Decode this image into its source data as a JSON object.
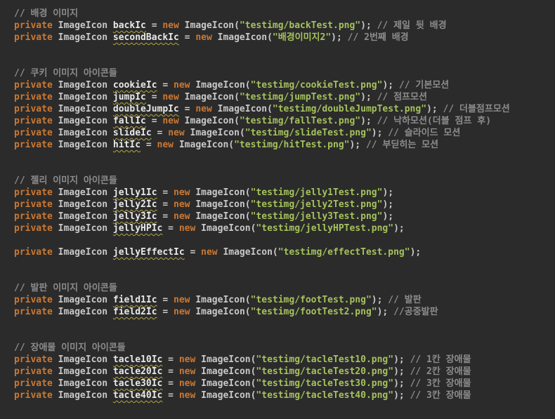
{
  "editor": {
    "lines": [
      {
        "type": "comment",
        "text": "// 배경 이미지"
      },
      {
        "type": "decl",
        "kw": "private",
        "type_name": "ImageIcon",
        "ident": "backIc",
        "eq": " = ",
        "new_kw": "new",
        "ctor": " ImageIcon(",
        "str": "\"testimg/backTest.png\"",
        "close": ");",
        "trail": " // 제일 뒷 배경"
      },
      {
        "type": "decl",
        "kw": "private",
        "type_name": "ImageIcon",
        "ident": "secondBackIc",
        "eq": " = ",
        "new_kw": "new",
        "ctor": " ImageIcon(",
        "str": "\"배경이미지2\"",
        "close": ");",
        "trail": " // 2번째 배경"
      },
      {
        "type": "blank"
      },
      {
        "type": "blank"
      },
      {
        "type": "comment",
        "text": "// 쿠키 이미지 아이콘들"
      },
      {
        "type": "decl",
        "kw": "private",
        "type_name": "ImageIcon",
        "ident": "cookieIc",
        "eq": " = ",
        "new_kw": "new",
        "ctor": " ImageIcon(",
        "str": "\"testimg/cookieTest.png\"",
        "close": ");",
        "trail": " // 기본모션"
      },
      {
        "type": "decl",
        "kw": "private",
        "type_name": "ImageIcon",
        "ident": "jumpIc",
        "eq": " = ",
        "new_kw": "new",
        "ctor": " ImageIcon(",
        "str": "\"testimg/jumpTest.png\"",
        "close": ");",
        "trail": " // 점프모션"
      },
      {
        "type": "decl",
        "kw": "private",
        "type_name": "ImageIcon",
        "ident": "doubleJumpIc",
        "eq": " = ",
        "new_kw": "new",
        "ctor": " ImageIcon(",
        "str": "\"testimg/doubleJumpTest.png\"",
        "close": ");",
        "trail": " // 더블점프모션"
      },
      {
        "type": "decl",
        "kw": "private",
        "type_name": "ImageIcon",
        "ident": "fallIc",
        "eq": " = ",
        "new_kw": "new",
        "ctor": " ImageIcon(",
        "str": "\"testimg/fallTest.png\"",
        "close": ");",
        "trail": " // 낙하모션(더블 점프 후)"
      },
      {
        "type": "decl",
        "kw": "private",
        "type_name": "ImageIcon",
        "ident": "slideIc",
        "eq": " = ",
        "new_kw": "new",
        "ctor": " ImageIcon(",
        "str": "\"testimg/slideTest.png\"",
        "close": ");",
        "trail": " // 슬라이드 모션"
      },
      {
        "type": "decl",
        "kw": "private",
        "type_name": "ImageIcon",
        "ident": "hitIc",
        "eq": " = ",
        "new_kw": "new",
        "ctor": " ImageIcon(",
        "str": "\"testimg/hitTest.png\"",
        "close": ");",
        "trail": " // 부딛히는 모션"
      },
      {
        "type": "blank"
      },
      {
        "type": "blank"
      },
      {
        "type": "comment",
        "text": "// 젤리 이미지 아이콘들"
      },
      {
        "type": "decl",
        "kw": "private",
        "type_name": "ImageIcon",
        "ident": "jelly1Ic",
        "eq": " = ",
        "new_kw": "new",
        "ctor": " ImageIcon(",
        "str": "\"testimg/jelly1Test.png\"",
        "close": ");",
        "trail": ""
      },
      {
        "type": "decl",
        "kw": "private",
        "type_name": "ImageIcon",
        "ident": "jelly2Ic",
        "eq": " = ",
        "new_kw": "new",
        "ctor": " ImageIcon(",
        "str": "\"testimg/jelly2Test.png\"",
        "close": ");",
        "trail": ""
      },
      {
        "type": "decl",
        "kw": "private",
        "type_name": "ImageIcon",
        "ident": "jelly3Ic",
        "eq": " = ",
        "new_kw": "new",
        "ctor": " ImageIcon(",
        "str": "\"testimg/jelly3Test.png\"",
        "close": ");",
        "trail": ""
      },
      {
        "type": "decl",
        "kw": "private",
        "type_name": "ImageIcon",
        "ident": "jellyHPIc",
        "eq": " = ",
        "new_kw": "new",
        "ctor": " ImageIcon(",
        "str": "\"testimg/jellyHPTest.png\"",
        "close": ");",
        "trail": ""
      },
      {
        "type": "blank"
      },
      {
        "type": "decl",
        "kw": "private",
        "type_name": "ImageIcon",
        "ident": "jellyEffectIc",
        "eq": " = ",
        "new_kw": "new",
        "ctor": " ImageIcon(",
        "str": "\"testimg/effectTest.png\"",
        "close": ");",
        "trail": ""
      },
      {
        "type": "blank"
      },
      {
        "type": "blank"
      },
      {
        "type": "comment",
        "text": "// 발판 이미지 아이콘들"
      },
      {
        "type": "decl",
        "kw": "private",
        "type_name": "ImageIcon",
        "ident": "field1Ic",
        "eq": " = ",
        "new_kw": "new",
        "ctor": " ImageIcon(",
        "str": "\"testimg/footTest.png\"",
        "close": ");",
        "trail": " // 발판"
      },
      {
        "type": "decl",
        "kw": "private",
        "type_name": "ImageIcon",
        "ident": "field2Ic",
        "eq": " = ",
        "new_kw": "new",
        "ctor": " ImageIcon(",
        "str": "\"testimg/footTest2.png\"",
        "close": ");",
        "trail": " //공중발판"
      },
      {
        "type": "blank"
      },
      {
        "type": "blank"
      },
      {
        "type": "comment",
        "text": "// 장애물 이미지 아이콘들"
      },
      {
        "type": "decl",
        "kw": "private",
        "type_name": "ImageIcon",
        "ident": "tacle10Ic",
        "eq": " = ",
        "new_kw": "new",
        "ctor": " ImageIcon(",
        "str": "\"testimg/tacleTest10.png\"",
        "close": ");",
        "trail": " // 1칸 장애물"
      },
      {
        "type": "decl",
        "kw": "private",
        "type_name": "ImageIcon",
        "ident": "tacle20Ic",
        "eq": " = ",
        "new_kw": "new",
        "ctor": " ImageIcon(",
        "str": "\"testimg/tacleTest20.png\"",
        "close": ");",
        "trail": " // 2칸 장애물"
      },
      {
        "type": "decl",
        "kw": "private",
        "type_name": "ImageIcon",
        "ident": "tacle30Ic",
        "eq": " = ",
        "new_kw": "new",
        "ctor": " ImageIcon(",
        "str": "\"testimg/tacleTest30.png\"",
        "close": ");",
        "trail": " // 3칸 장애물"
      },
      {
        "type": "decl",
        "kw": "private",
        "type_name": "ImageIcon",
        "ident": "tacle40Ic",
        "eq": " = ",
        "new_kw": "new",
        "ctor": " ImageIcon(",
        "str": "\"testimg/tacleTest40.png\"",
        "close": ");",
        "trail": " // 3칸 장애물"
      }
    ]
  }
}
